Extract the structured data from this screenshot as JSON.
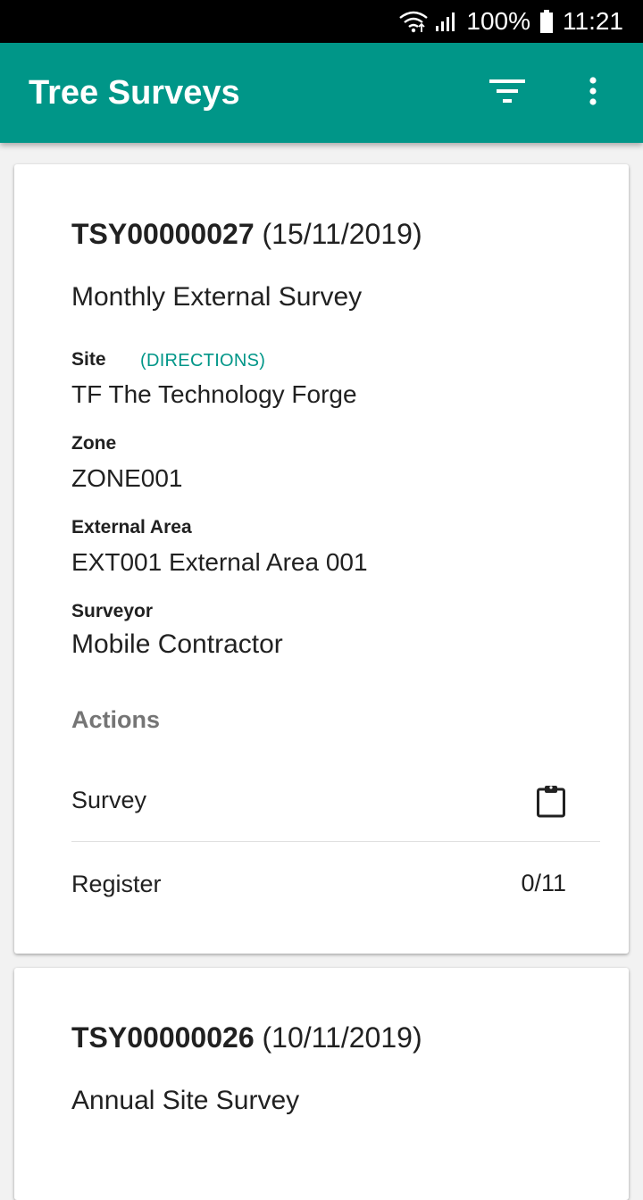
{
  "status_bar": {
    "battery": "100%",
    "time": "11:21"
  },
  "app_bar": {
    "title": "Tree Surveys",
    "icons": [
      "filter-icon",
      "more-vert-icon"
    ]
  },
  "surveys": [
    {
      "id": "TSY00000027",
      "date": "(15/11/2019)",
      "name": "Monthly External Survey",
      "site_label": "Site",
      "directions_label": "(DIRECTIONS)",
      "site_value": "TF The Technology Forge",
      "zone_label": "Zone",
      "zone_value": "ZONE001",
      "external_area_label": "External Area",
      "external_area_value": "EXT001 External Area 001",
      "surveyor_label": "Surveyor",
      "surveyor_value": "Mobile Contractor",
      "actions_heading": "Actions",
      "survey_action_label": "Survey",
      "survey_action_icon": "clipboard-icon",
      "register_label": "Register",
      "register_count": "0/11"
    },
    {
      "id": "TSY00000026",
      "date": "(10/11/2019)",
      "name": "Annual Site Survey"
    }
  ],
  "colors": {
    "primary": "#009688",
    "status_bar": "#000000",
    "background": "#f2f2f2"
  }
}
